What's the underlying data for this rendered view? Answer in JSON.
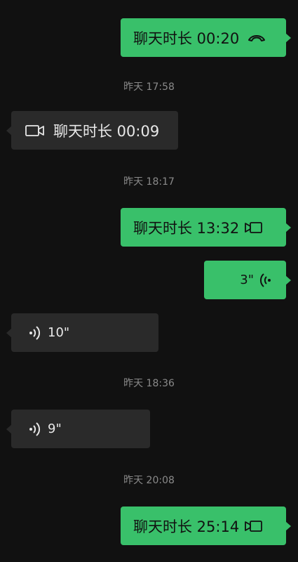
{
  "messages": [
    {
      "type": "call",
      "side": "out",
      "label": "聊天时长 00:20",
      "icon": "phone-hangup-icon"
    },
    {
      "type": "timestamp",
      "text": "昨天 17:58"
    },
    {
      "type": "call",
      "side": "in",
      "label": "聊天时长 00:09",
      "icon": "video-camera-icon"
    },
    {
      "type": "timestamp",
      "text": "昨天 18:17"
    },
    {
      "type": "call",
      "side": "out",
      "label": "聊天时长 13:32",
      "icon": "video-camera-icon"
    },
    {
      "type": "voice",
      "side": "out",
      "duration": "3\"",
      "icon": "voice-wave-icon"
    },
    {
      "type": "voice",
      "side": "in",
      "duration": "10\"",
      "icon": "voice-wave-icon"
    },
    {
      "type": "timestamp",
      "text": "昨天 18:36"
    },
    {
      "type": "voice",
      "side": "in",
      "duration": "9\"",
      "icon": "voice-wave-icon"
    },
    {
      "type": "timestamp",
      "text": "昨天 20:08"
    },
    {
      "type": "call",
      "side": "out",
      "label": "聊天时长 25:14",
      "icon": "video-camera-icon"
    }
  ],
  "colors": {
    "background": "#111111",
    "outgoing_bubble": "#39c06a",
    "incoming_bubble": "#2a2a2a",
    "timestamp_text": "#8a8a8a"
  }
}
